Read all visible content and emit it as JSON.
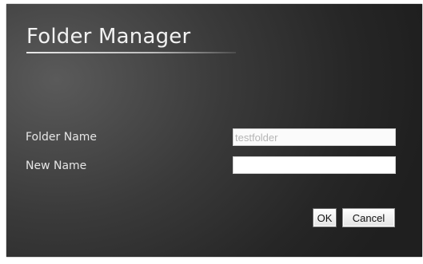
{
  "dialog": {
    "title": "Folder Manager",
    "fields": {
      "folder_name": {
        "label": "Folder Name",
        "value": "testfolder"
      },
      "new_name": {
        "label": "New Name",
        "value": ""
      }
    },
    "buttons": {
      "ok_label": "OK",
      "cancel_label": "Cancel"
    }
  },
  "colors": {
    "background_dark": "#262626",
    "background_light": "#5a5a5a",
    "title_text": "#f2f2f2",
    "label_text": "#e6e6e6",
    "readonly_text": "#b5b5b5"
  }
}
